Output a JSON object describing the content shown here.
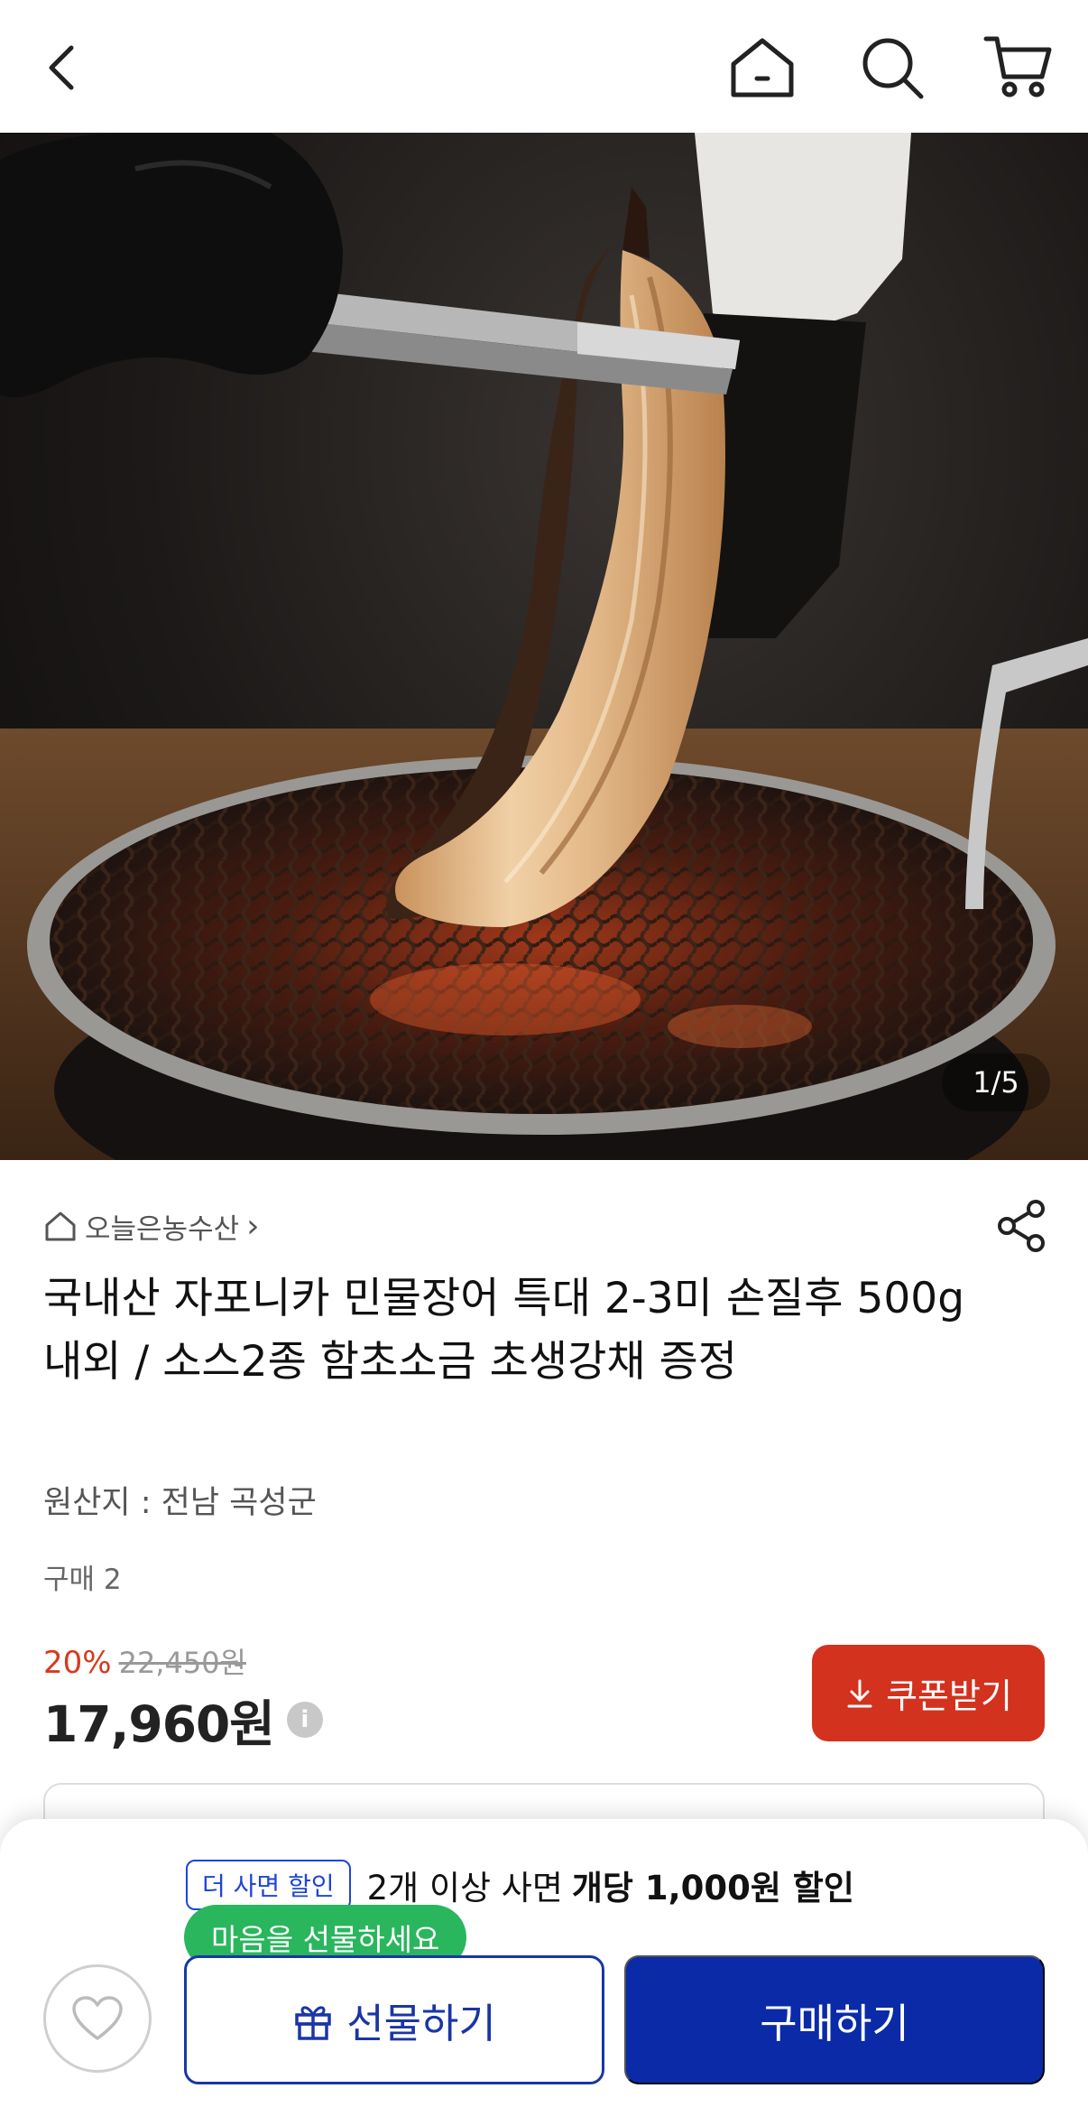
{
  "header": {
    "icons": [
      "back-arrow-icon",
      "home-icon",
      "search-icon",
      "cart-icon"
    ]
  },
  "gallery": {
    "counter": "1/5"
  },
  "product": {
    "store_name": "오늘은농수산",
    "store_chevron": "›",
    "title": "국내산 자포니카 민물장어 특대 2-3미 손질후 500g 내외 / 소스2종 함초소금 초생강채 증정",
    "origin": "원산지 : 전남 곡성군",
    "purchases": "구매 2",
    "discount_rate": "20%",
    "original_price": "22,450원",
    "final_price": "17,960원",
    "info_mark": "i"
  },
  "coupon": {
    "label": "쿠폰받기"
  },
  "bottom_sheet": {
    "promo_badge": "더 사면 할인",
    "promo_text": "2개 이상 사면",
    "promo_strong": "개당 1,000원 할인",
    "tooltip": "마음을 선물하세요",
    "gift_label": "선물하기",
    "buy_label": "구매하기"
  },
  "colors": {
    "discount": "#d63a1e",
    "coupon_bg": "#d3321e",
    "primary_blue": "#0a2aa8",
    "tooltip_green": "#29b65d"
  }
}
